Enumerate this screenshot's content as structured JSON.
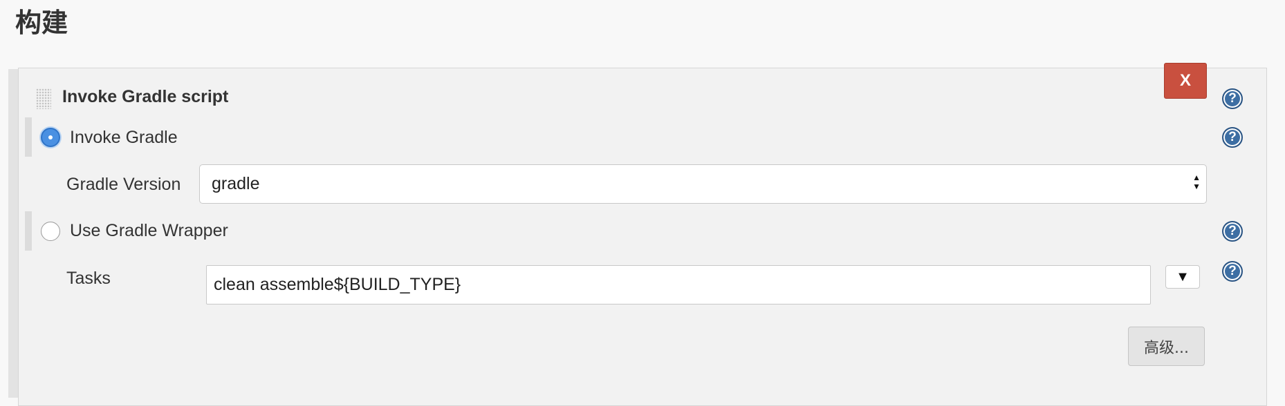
{
  "section": {
    "title": "构建"
  },
  "step": {
    "title": "Invoke Gradle script",
    "delete_label": "X"
  },
  "help": {
    "glyph": "?"
  },
  "options": {
    "invoke_gradle": {
      "label": "Invoke Gradle",
      "selected": true
    },
    "use_wrapper": {
      "label": "Use Gradle Wrapper",
      "selected": false
    }
  },
  "gradle_version": {
    "label": "Gradle Version",
    "value": "gradle"
  },
  "tasks": {
    "label": "Tasks",
    "value": "clean assemble${BUILD_TYPE}",
    "dropdown_glyph": "▼"
  },
  "advanced": {
    "label": "高级..."
  },
  "colors": {
    "delete_button": "#c9503f",
    "help_icon": "#3d6ea3",
    "radio_selected": "#4a90e2"
  }
}
